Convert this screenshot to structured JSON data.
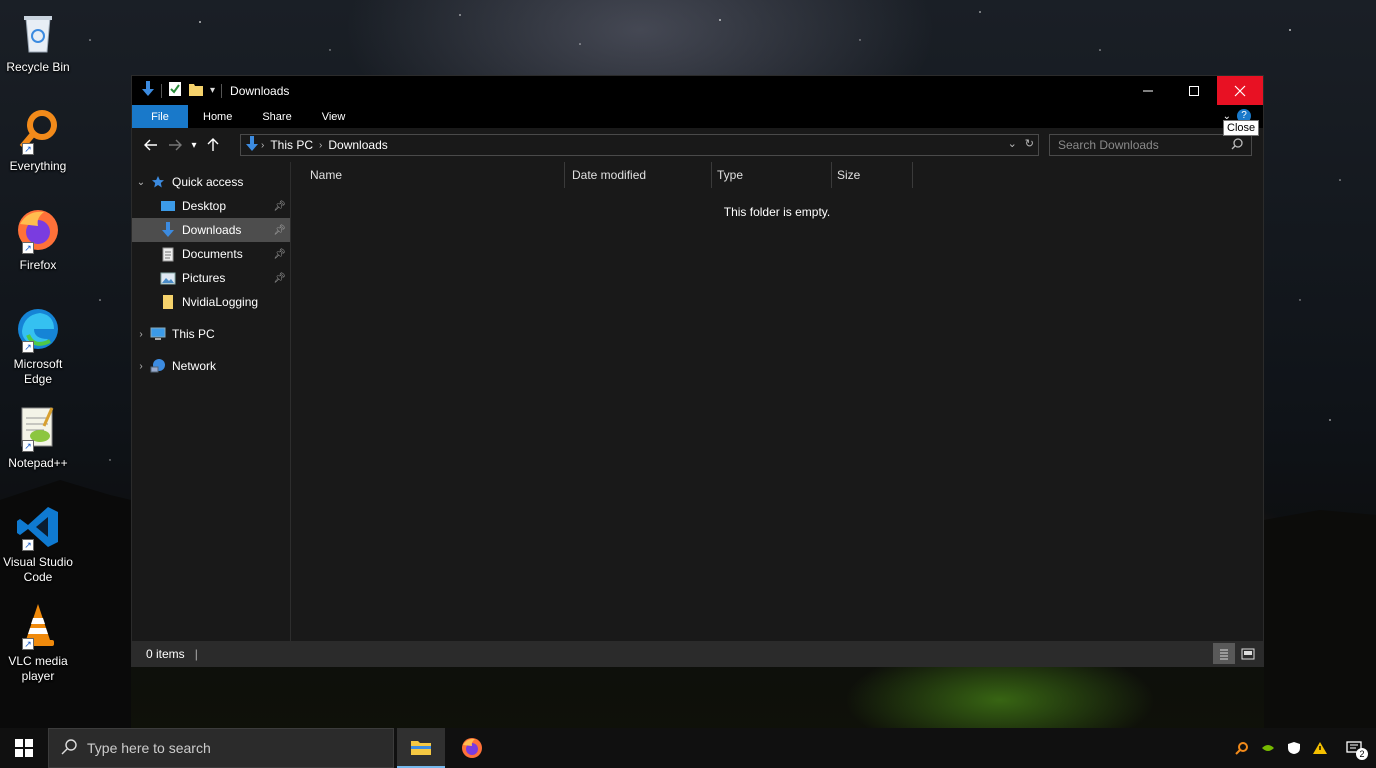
{
  "desktop": {
    "icons": [
      {
        "label": "Recycle Bin"
      },
      {
        "label": "Everything"
      },
      {
        "label": "Firefox"
      },
      {
        "label": "Microsoft Edge"
      },
      {
        "label": "Notepad++"
      },
      {
        "label": "Visual Studio Code"
      },
      {
        "label": "VLC media player"
      }
    ]
  },
  "window": {
    "title": "Downloads",
    "ribbon_tabs": [
      "File",
      "Home",
      "Share",
      "View"
    ],
    "tooltip": "Close",
    "help_label": "?",
    "address": {
      "crumbs": [
        "This PC",
        "Downloads"
      ]
    },
    "search": {
      "placeholder": "Search Downloads"
    },
    "nav_pane": {
      "quick_access": "Quick access",
      "items": [
        {
          "label": "Desktop",
          "pinned": true
        },
        {
          "label": "Downloads",
          "pinned": true,
          "selected": true
        },
        {
          "label": "Documents",
          "pinned": true
        },
        {
          "label": "Pictures",
          "pinned": true
        },
        {
          "label": "NvidiaLogging",
          "pinned": false
        }
      ],
      "this_pc": "This PC",
      "network": "Network"
    },
    "columns": [
      "Name",
      "Date modified",
      "Type",
      "Size"
    ],
    "empty_message": "This folder is empty.",
    "status": "0 items"
  },
  "taskbar": {
    "search_placeholder": "Type here to search",
    "notification_count": "2"
  },
  "colors": {
    "accent": "#1979ca",
    "close_red": "#e81123",
    "window_bg": "#191919"
  }
}
